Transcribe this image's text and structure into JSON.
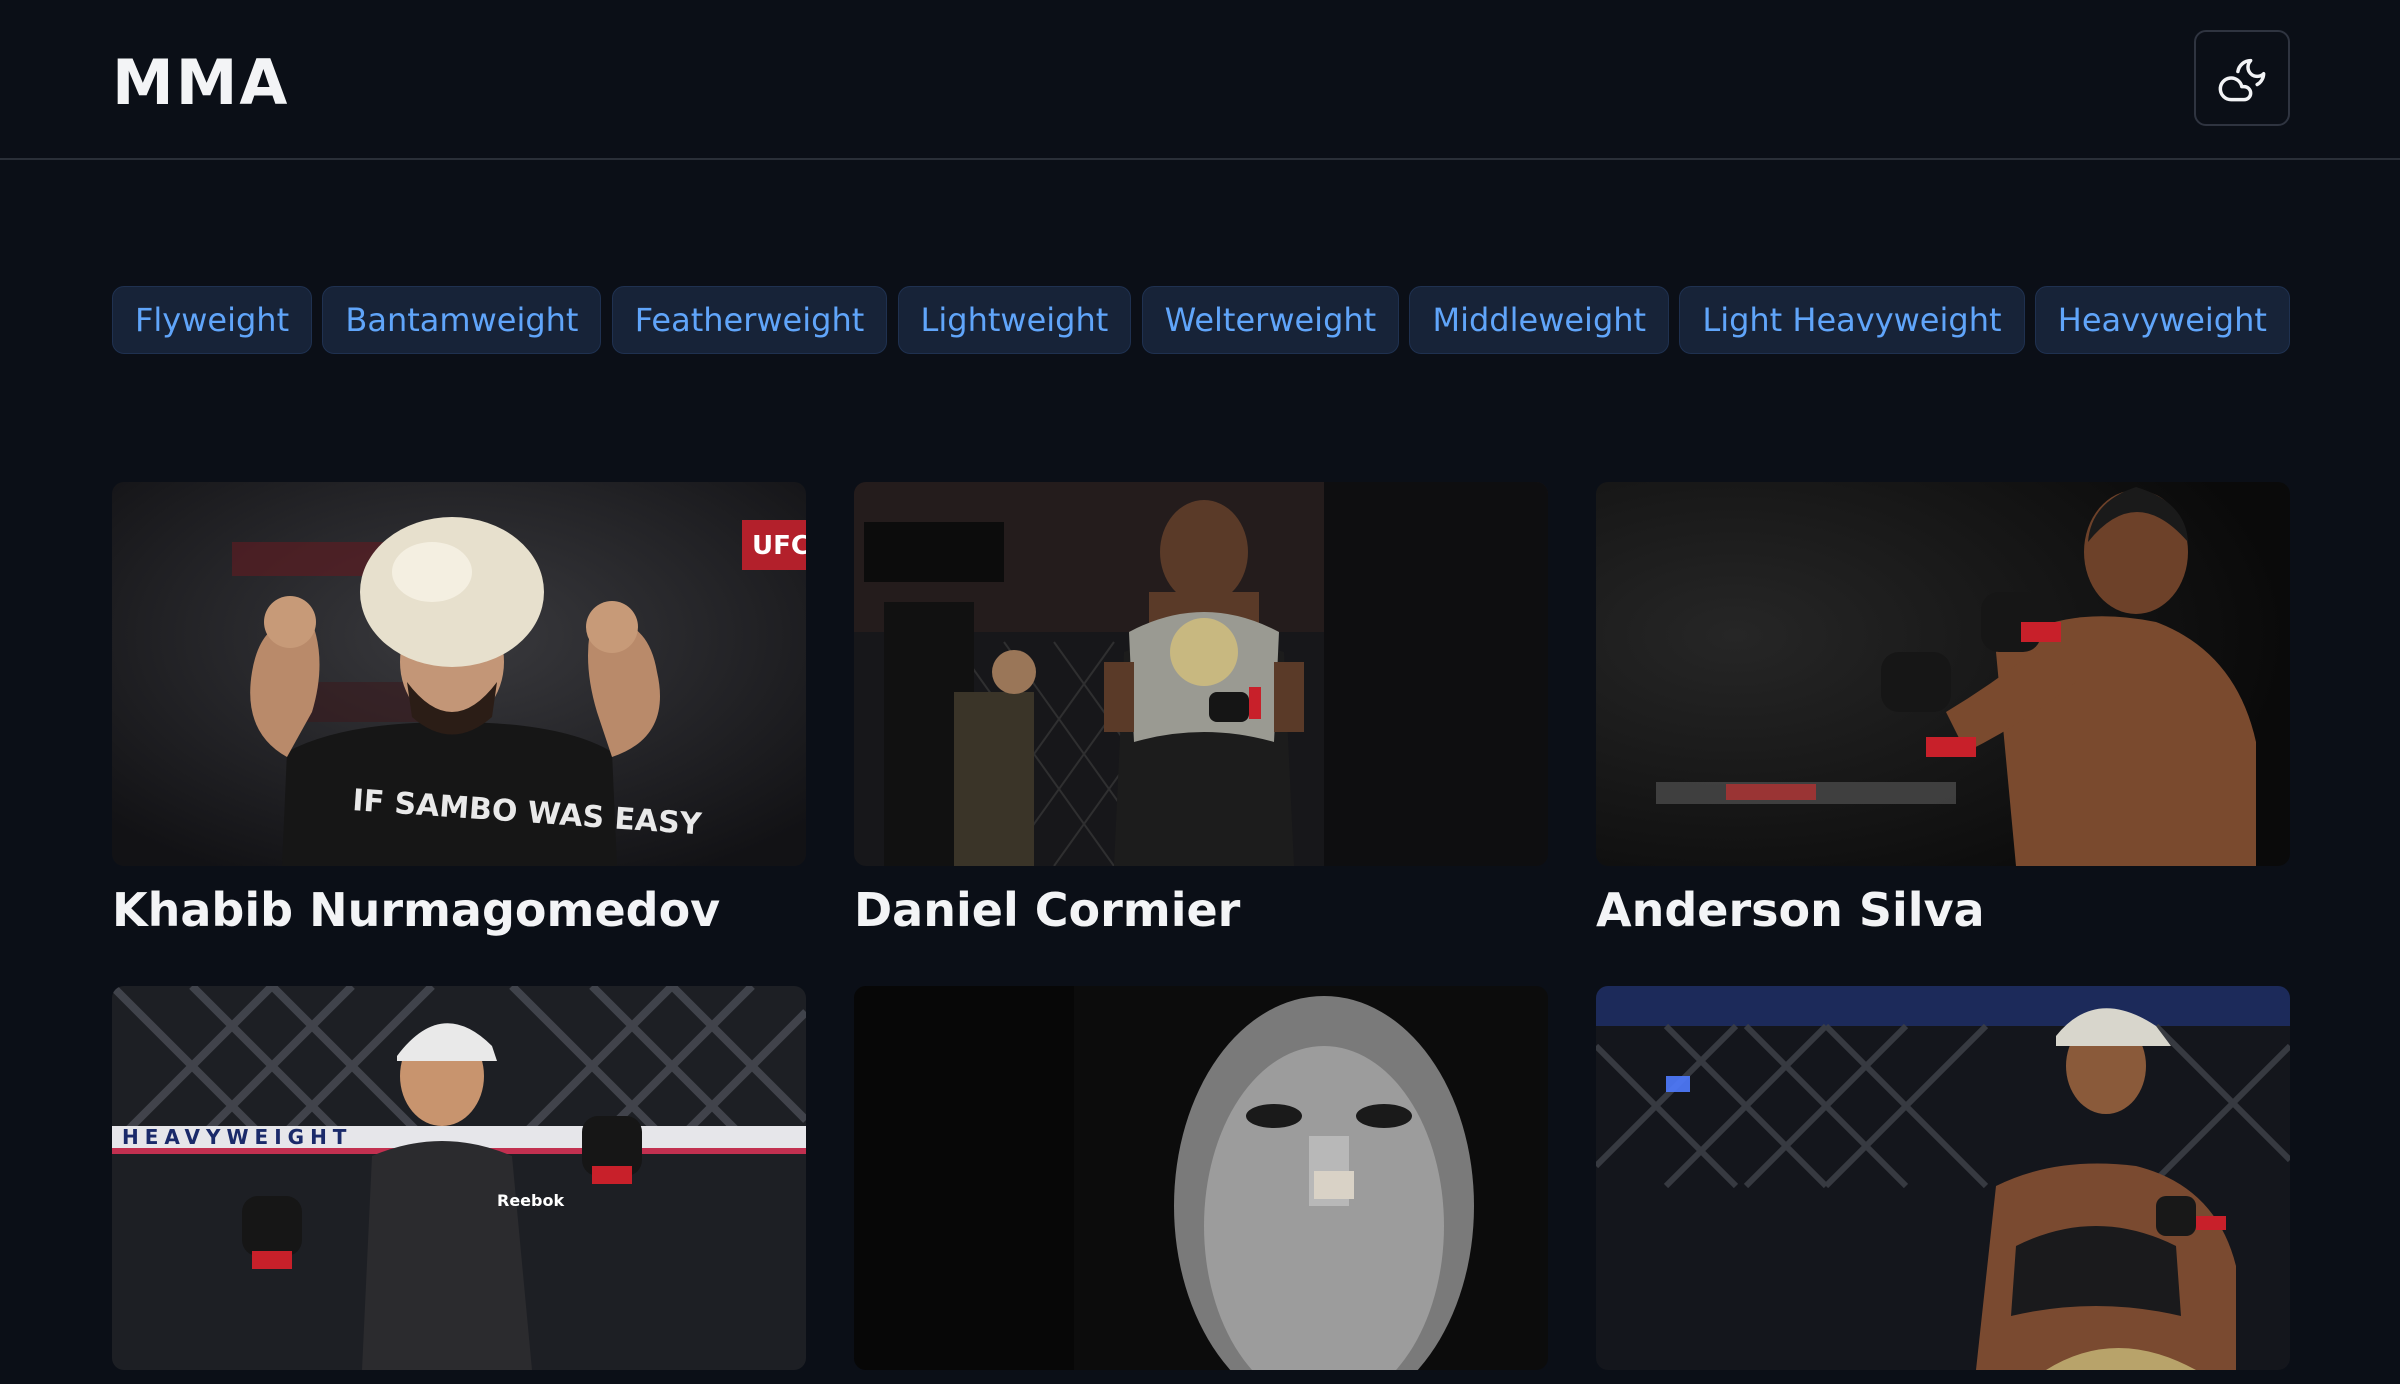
{
  "header": {
    "logo": "MMA",
    "theme_toggle_icon": "cloud-moon-icon"
  },
  "categories": [
    "Flyweight",
    "Bantamweight",
    "Featherweight",
    "Lightweight",
    "Welterweight",
    "Middleweight",
    "Light Heavyweight",
    "Heavyweight"
  ],
  "fighters": [
    {
      "name": "Khabib Nurmagomedov"
    },
    {
      "name": "Daniel Cormier"
    },
    {
      "name": "Anderson Silva"
    },
    {
      "name": ""
    },
    {
      "name": ""
    },
    {
      "name": ""
    }
  ],
  "photo_text": {
    "khabib_shirt_line1": "IF SAMBO WAS EASY",
    "ufc_logo": "UFC",
    "heavyweight_banner": "HEAVYWEIGHT",
    "reebok": "Reebok"
  },
  "colors": {
    "background": "#0b0f17",
    "chip_bg": "#172338",
    "chip_text": "#60a5fa",
    "text": "#f3f4f6",
    "divider": "#2a2f38"
  }
}
